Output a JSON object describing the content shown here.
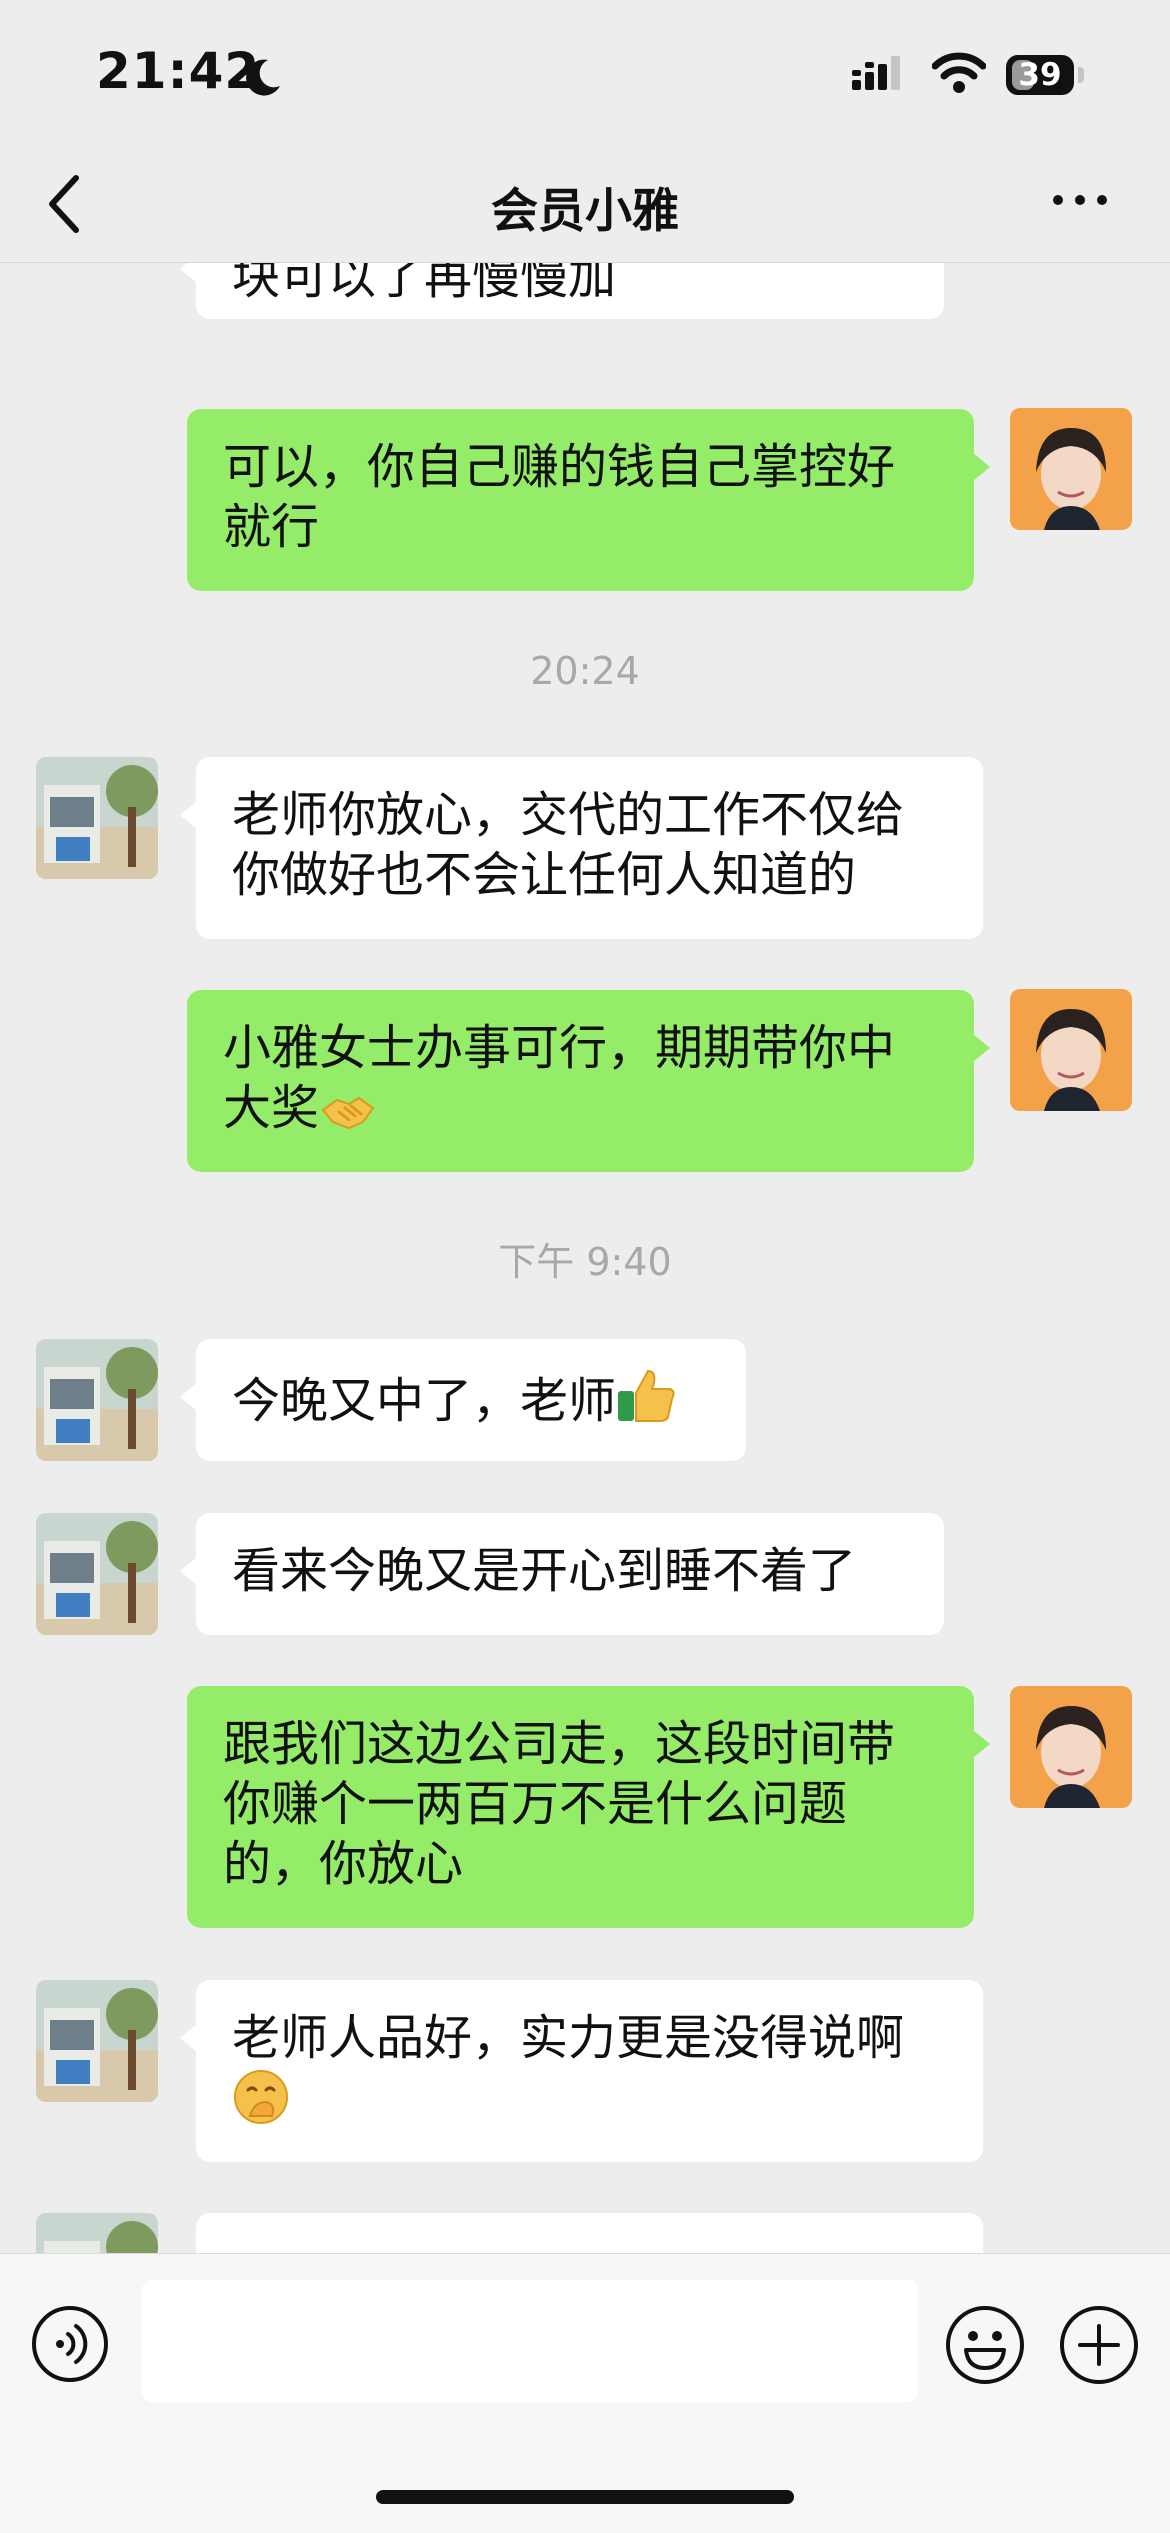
{
  "status_bar": {
    "time": "21:42",
    "battery": "39",
    "battery_level": 0.39
  },
  "nav": {
    "title": "会员小雅"
  },
  "messages": [
    {
      "side": "in",
      "text": "块可以了再慢慢加"
    },
    {
      "side": "out",
      "text": "可以，你自己赚的钱自己掌控好就行"
    },
    {
      "timestamp": "20:24"
    },
    {
      "side": "in",
      "text": "老师你放心，交代的工作不仅给你做好也不会让任何人知道的"
    },
    {
      "side": "out",
      "text": "小雅女士办事可行，期期带你中大奖",
      "emoji": "handshake-emoji"
    },
    {
      "timestamp": "下午 9:40"
    },
    {
      "side": "in",
      "text": "今晚又中了，老师",
      "emoji": "thumbs-up-emoji"
    },
    {
      "side": "in",
      "text": "看来今晚又是开心到睡不着了"
    },
    {
      "side": "out",
      "text": "跟我们这边公司走，这段时间带你赚个一两百万不是什么问题的，你放心"
    },
    {
      "side": "in",
      "text": "老师人品好，实力更是没得说啊",
      "emoji": "hand-over-mouth-emoji"
    }
  ],
  "input_bar": {
    "placeholder": "",
    "icons": [
      "voice-icon",
      "emoji-icon",
      "plus-icon"
    ]
  }
}
